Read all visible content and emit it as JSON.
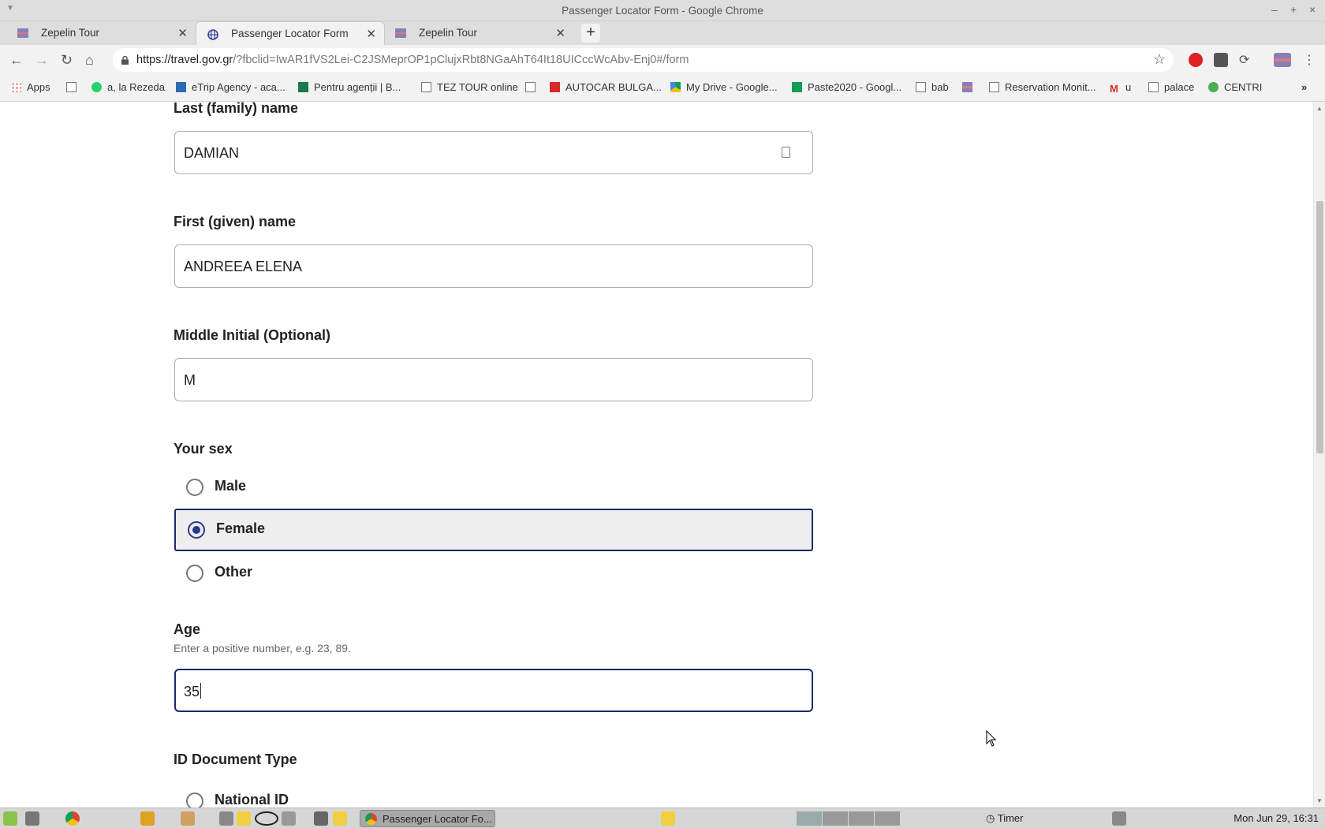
{
  "window": {
    "title": "Passenger Locator Form - Google Chrome"
  },
  "tabs": [
    {
      "label": "Zepelin Tour"
    },
    {
      "label": "Passenger Locator Form"
    },
    {
      "label": "Zepelin Tour"
    }
  ],
  "address_bar": {
    "host": "https://travel.gov.gr",
    "path": "/?fbclid=IwAR1fVS2Lei-C2JSMeprOP1pClujxRbt8NGaAhT64It18UICccWcAbv-Enj0#/form"
  },
  "bookmarks": [
    "Apps",
    "",
    "a, la Rezeda",
    "eTrip Agency - aca...",
    "Pentru agenții | B...",
    "TEZ TOUR online",
    "",
    "AUTOCAR BULGA...",
    "My Drive - Google...",
    "Paste2020 - Googl...",
    "bab",
    "",
    "Reservation Monit...",
    "u",
    "palace",
    "CENTRI"
  ],
  "form": {
    "last_name": {
      "label": "Last (family) name",
      "value": "DAMIAN"
    },
    "first_name": {
      "label": "First (given) name",
      "value": "ANDREEA ELENA"
    },
    "middle_initial": {
      "label": "Middle Initial (Optional)",
      "value": "M"
    },
    "sex": {
      "label": "Your sex",
      "options": [
        "Male",
        "Female",
        "Other"
      ],
      "selected": "Female"
    },
    "age": {
      "label": "Age",
      "hint": "Enter a positive number, e.g. 23, 89.",
      "value": "35"
    },
    "id_document": {
      "label": "ID Document Type",
      "options": [
        "National ID"
      ]
    }
  },
  "taskbar": {
    "window_label": "Passenger Locator Fo...",
    "timer_label": "Timer",
    "clock": "Mon Jun 29, 16:31"
  },
  "colors": {
    "accent": "#1b2a6b",
    "selected_bg": "#eeeeee"
  }
}
